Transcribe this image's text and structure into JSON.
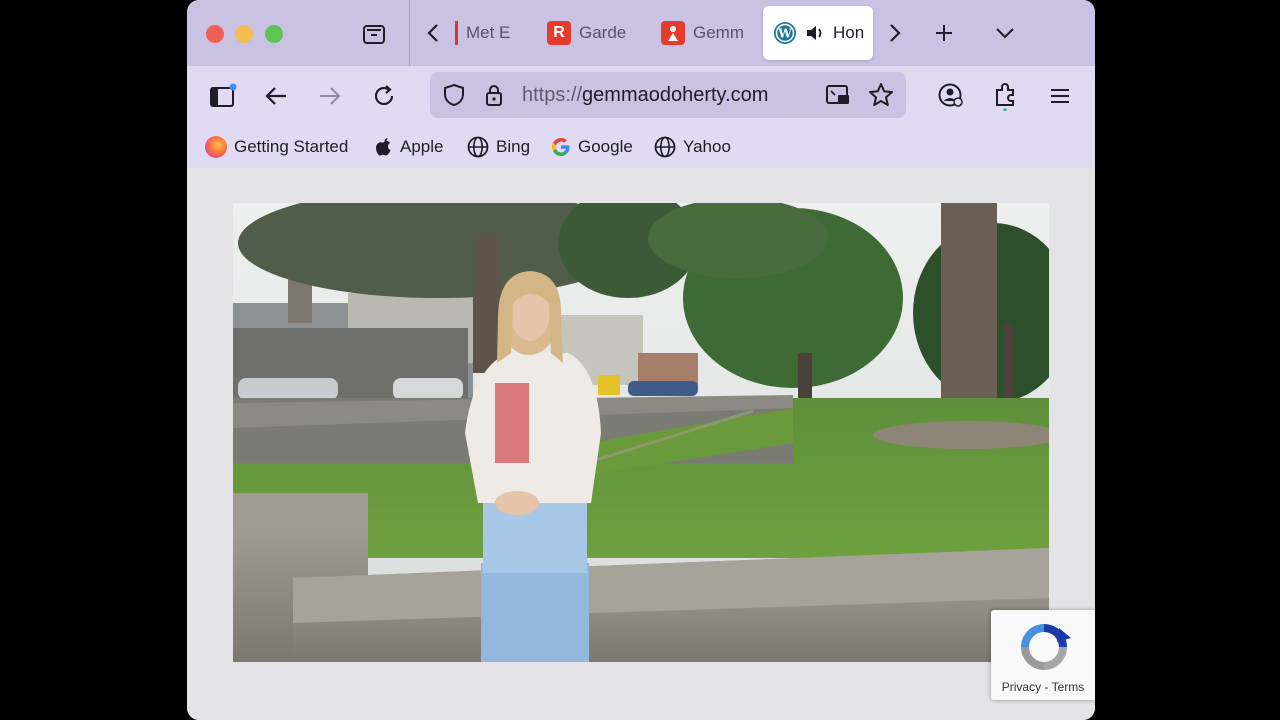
{
  "tabs": [
    {
      "label": "Met E",
      "icon": "met-icon",
      "active": false
    },
    {
      "label": "Garde",
      "icon": "r-icon",
      "active": false
    },
    {
      "label": "Gemm",
      "icon": "gemma-icon",
      "active": false
    },
    {
      "label": "Hon",
      "icon": "wordpress-icon",
      "active": true,
      "audio": true
    }
  ],
  "url": {
    "scheme": "https://",
    "host": "gemmaodoherty.com"
  },
  "bookmarks": [
    {
      "label": "Getting Started",
      "icon": "firefox-icon"
    },
    {
      "label": "Apple",
      "icon": "apple-icon"
    },
    {
      "label": "Bing",
      "icon": "globe-icon"
    },
    {
      "label": "Google",
      "icon": "google-icon"
    },
    {
      "label": "Yahoo",
      "icon": "globe-icon"
    }
  ],
  "recaptcha": {
    "privacy": "Privacy",
    "separator": " - ",
    "terms": "Terms"
  },
  "colors": {
    "tabbar": "#c9c2e3",
    "toolbar": "#e0dbf3",
    "urlbar": "#c9c2e3",
    "content_bg": "#e4e3e5"
  }
}
